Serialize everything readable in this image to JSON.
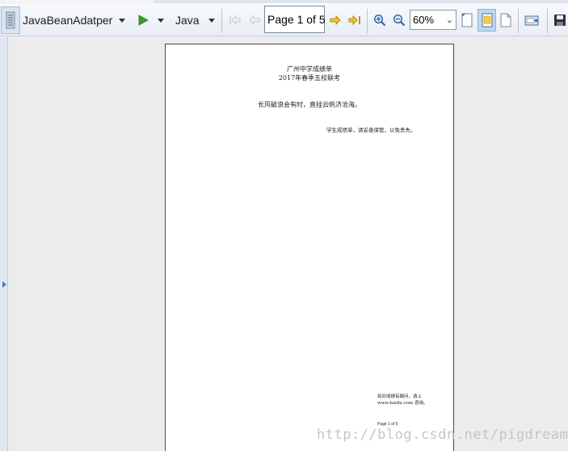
{
  "toolbar": {
    "datasource_label": "JavaBeanAdatper",
    "language_label": "Java",
    "page_indicator": "Page 1 of 5",
    "zoom_value": "60%",
    "icons": [
      "sidebar-toggle-icon",
      "run-icon",
      "first-page-icon",
      "previous-page-icon",
      "next-page-icon",
      "last-page-icon",
      "zoom-in-icon",
      "zoom-out-icon",
      "fit-page-icon",
      "actual-size-icon",
      "fit-width-icon",
      "export-icon",
      "save-icon"
    ],
    "colors": {
      "accent": "#3a9b2c",
      "nav_arrow": "#e8b518",
      "active_bg": "#bcd8f2"
    }
  },
  "report": {
    "title": "广州中学成绩单",
    "subtitle": "2017年春季五校联考",
    "quote": "长风破浪会有时，直挂云帆济沧海。",
    "notice": "学生成绩单，请妥善保管，以免丢失。",
    "footer_line1": "如对成绩有疑问，请上",
    "footer_line2": "www.baidu.com 咨询。",
    "page_footer": "Page 1 of 5"
  },
  "watermark": "http://blog.csdn.net/pigdreams"
}
